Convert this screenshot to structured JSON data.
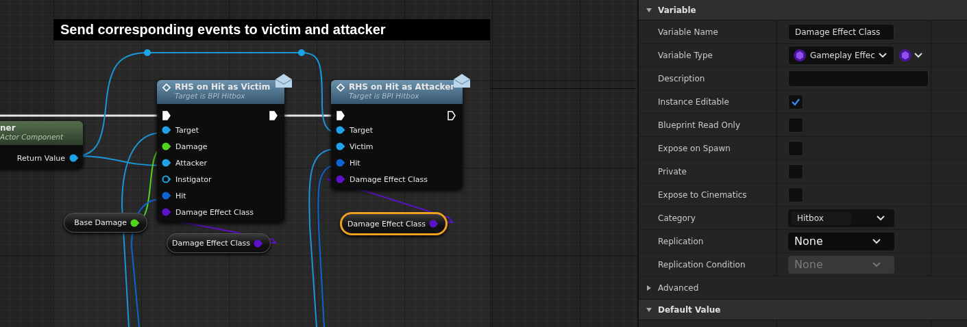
{
  "graph": {
    "comment": {
      "title": "Send corresponding events to victim and attacker"
    },
    "nodes": [
      {
        "kind": "function",
        "title": "ner",
        "subtitle": "Actor Component",
        "pins": [
          {
            "label": "Return Value",
            "color": "#1fa3e8",
            "connected": true
          }
        ]
      },
      {
        "kind": "message",
        "title": "RHS on Hit as Victim",
        "subtitle": "Target is BPI Hitbox",
        "exec_in": {
          "connected": true
        },
        "exec_out": {
          "connected": true
        },
        "pins": [
          {
            "label": "Target",
            "color": "#1fa3e8",
            "connected": true
          },
          {
            "label": "Damage",
            "color": "#4fd51c",
            "connected": true
          },
          {
            "label": "Attacker",
            "color": "#1fa3e8",
            "connected": true
          },
          {
            "label": "Instigator",
            "color": "#1fa3e8",
            "connected": false
          },
          {
            "label": "Hit",
            "color": "#0c63d4",
            "connected": true
          },
          {
            "label": "Damage Effect Class",
            "color": "#5c12c8",
            "connected": true
          }
        ]
      },
      {
        "kind": "message",
        "title": "RHS on Hit as Attacker",
        "subtitle": "Target is BPI Hitbox",
        "exec_in": {
          "connected": true
        },
        "exec_out": {
          "connected": false
        },
        "pins": [
          {
            "label": "Target",
            "color": "#1fa3e8",
            "connected": true
          },
          {
            "label": "Victim",
            "color": "#1fa3e8",
            "connected": true
          },
          {
            "label": "Hit",
            "color": "#0c63d4",
            "connected": true
          },
          {
            "label": "Damage Effect Class",
            "color": "#5c12c8",
            "connected": true
          }
        ]
      },
      {
        "kind": "variable",
        "label": "Base Damage",
        "pin": {
          "color": "#4fd51c",
          "connected": true
        },
        "selected": false
      },
      {
        "kind": "variable",
        "label": "Damage Effect Class",
        "pin": {
          "color": "#5c12c8",
          "connected": true
        },
        "selected": false
      },
      {
        "kind": "variable",
        "label": "Damage Effect Class",
        "pin": {
          "color": "#5c12c8",
          "connected": true
        },
        "selected": true
      }
    ]
  },
  "details": {
    "sections": [
      {
        "kind": "category",
        "title": "Variable",
        "expanded": true,
        "rows": [
          {
            "kind": "text",
            "label": "Variable Name",
            "value": "Damage Effect Class"
          },
          {
            "kind": "type",
            "label": "Variable Type",
            "value": "Gameplay Effec"
          },
          {
            "kind": "wide_text",
            "label": "Description"
          },
          {
            "kind": "checkbox",
            "label": "Instance Editable",
            "checked": true
          },
          {
            "kind": "checkbox",
            "label": "Blueprint Read Only",
            "checked": false
          },
          {
            "kind": "checkbox",
            "label": "Expose on Spawn",
            "checked": false
          },
          {
            "kind": "checkbox",
            "label": "Private",
            "checked": false
          },
          {
            "kind": "checkbox",
            "label": "Expose to Cinematics",
            "checked": false
          },
          {
            "kind": "combo",
            "label": "Category",
            "value": "Hitbox"
          },
          {
            "kind": "dropdown",
            "label": "Replication",
            "value": "None",
            "disabled": false
          },
          {
            "kind": "dropdown",
            "label": "Replication Condition",
            "value": "None",
            "disabled": true
          }
        ]
      },
      {
        "kind": "group",
        "title": "Advanced",
        "expanded": false
      },
      {
        "kind": "category",
        "title": "Default Value",
        "expanded": true
      }
    ]
  }
}
